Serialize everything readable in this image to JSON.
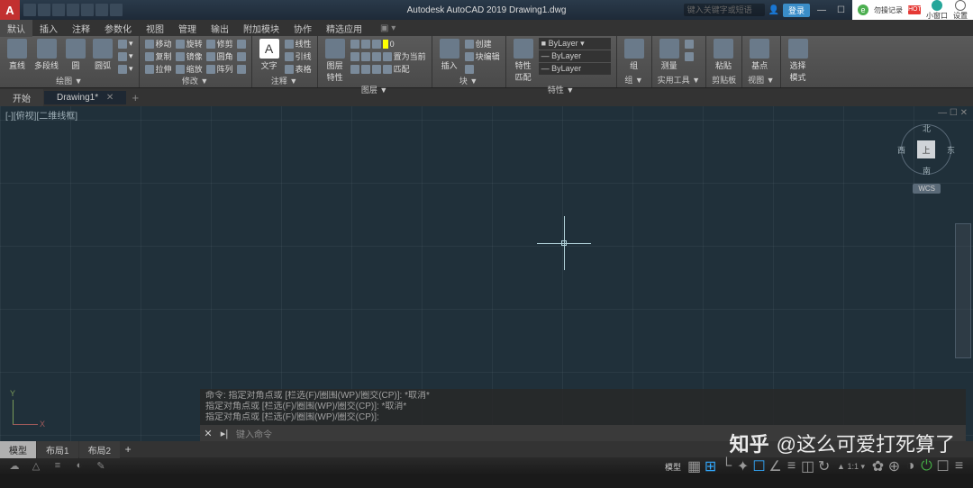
{
  "title": "Autodesk AutoCAD 2019   Drawing1.dwg",
  "app_logo": "A",
  "search_placeholder": "键入关键字或短语",
  "login_label": "登录",
  "browser": {
    "record": "勿操记录",
    "hot": "HOT",
    "window": "小窗口",
    "settings": "设置"
  },
  "ribbon_tabs": [
    "默认",
    "插入",
    "注释",
    "参数化",
    "视图",
    "管理",
    "输出",
    "附加模块",
    "协作",
    "精选应用"
  ],
  "ribbon_groups": {
    "draw": {
      "label": "绘图 ▼",
      "line": "直线",
      "polyline": "多段线",
      "circle": "圆",
      "arc": "圆弧"
    },
    "modify": {
      "label": "修改 ▼",
      "move": "移动",
      "copy": "复制",
      "stretch": "拉伸",
      "rotate": "旋转",
      "mirror": "镜像",
      "scale": "缩放",
      "trim": "修剪",
      "fillet": "圆角",
      "array": "阵列"
    },
    "annotate": {
      "label": "注释 ▼",
      "text": "文字",
      "linear": "线性",
      "leader": "引线",
      "table": "表格"
    },
    "layers": {
      "label": "图层 ▼",
      "btn": "图层\n特性",
      "combo": "ByLayer"
    },
    "block": {
      "label": "块 ▼",
      "insert": "插入",
      "create": "创建",
      "edit": "块编辑",
      "match": "匹配",
      "front": "置为当前"
    },
    "props": {
      "label": "特性 ▼",
      "match": "特性\n匹配",
      "layer_combo": "ByLayer",
      "bylayer2": "— ByLayer",
      "bylayer3": "— ByLayer"
    },
    "groups": {
      "label": "组 ▼",
      "group": "组"
    },
    "utils": {
      "label": "实用工具 ▼",
      "measure": "测量"
    },
    "clip": {
      "label": "剪贴板",
      "paste": "粘贴"
    },
    "view": {
      "label": "视图 ▼",
      "base": "基点"
    },
    "select": {
      "label": "",
      "mode": "选择\n模式"
    }
  },
  "doc_tabs": {
    "start": "开始",
    "file": "Drawing1*",
    "plus": "+"
  },
  "viewport_label": "[-][俯视][二维线框]",
  "viewport_min": "—",
  "viewport_max": "☐",
  "viewport_close": "✕",
  "viewcube": {
    "top": "上",
    "n": "北",
    "s": "南",
    "e": "东",
    "w": "西",
    "wcs": "WCS"
  },
  "ucs": {
    "x": "X",
    "y": "Y"
  },
  "command_history": [
    "命令: 指定对角点或 [栏选(F)/圈围(WP)/圈交(CP)]: *取消*",
    "指定对角点或 [栏选(F)/圈围(WP)/圈交(CP)]: *取消*",
    "指定对角点或 [栏选(F)/圈围(WP)/圈交(CP)]:"
  ],
  "command_prompt": "键入命令",
  "command_icon": "▸|",
  "layout_tabs": {
    "model": "模型",
    "l1": "布局1",
    "l2": "布局2",
    "plus": "+"
  },
  "status": {
    "model": "模型",
    "coords": "1:1",
    "icons": [
      "☁",
      "△",
      "≡",
      "◐",
      "✎"
    ]
  },
  "watermark": "知乎 @这么可爱打死算了"
}
